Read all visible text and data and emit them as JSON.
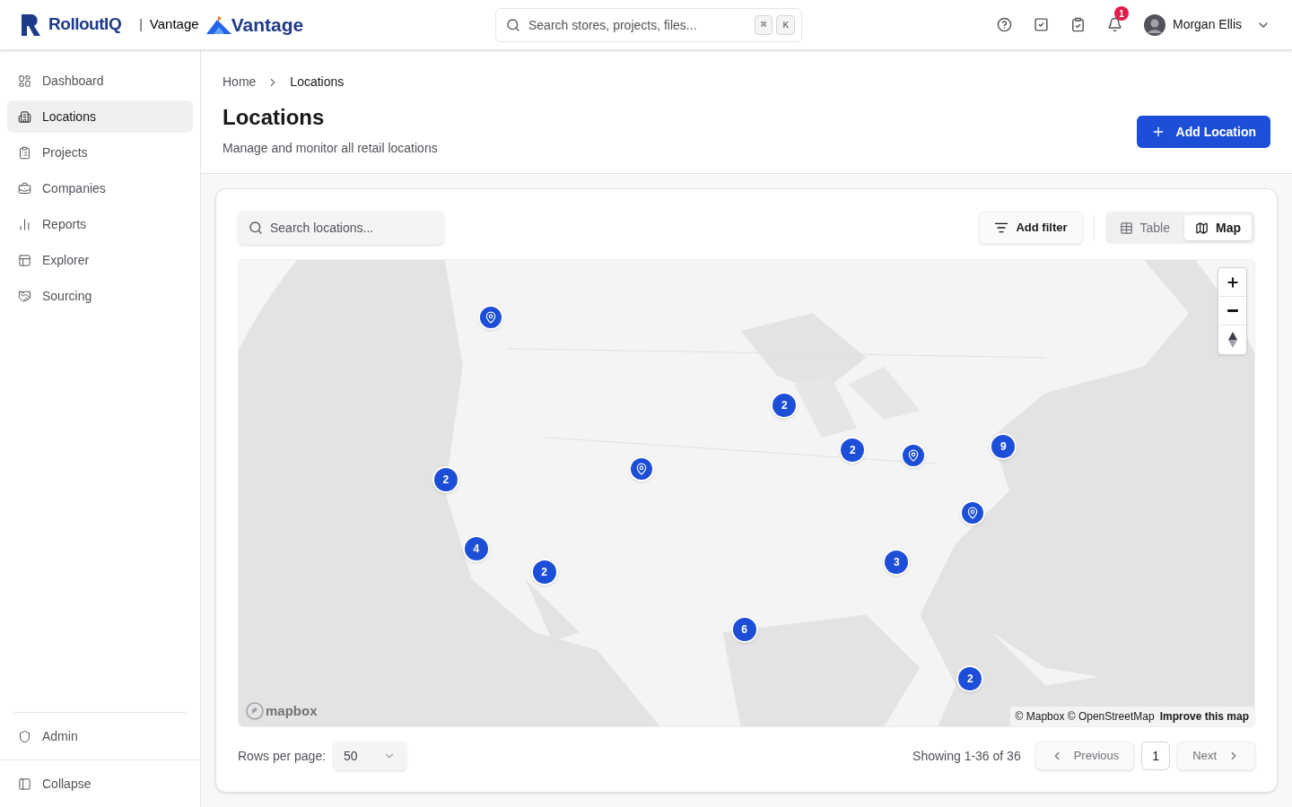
{
  "header": {
    "brand": "RolloutIQ",
    "separator": "|",
    "product_label": "Vantage",
    "product_logo": "Vantage",
    "search": {
      "placeholder": "Search stores, projects, files..."
    },
    "shortcut_keys": [
      "⌘",
      "K"
    ],
    "notification_count": "1",
    "user_name": "Morgan Ellis"
  },
  "sidebar": {
    "items": [
      {
        "label": "Dashboard",
        "selected": false
      },
      {
        "label": "Locations",
        "selected": true
      },
      {
        "label": "Projects",
        "selected": false
      },
      {
        "label": "Companies",
        "selected": false
      },
      {
        "label": "Reports",
        "selected": false
      },
      {
        "label": "Explorer",
        "selected": false
      },
      {
        "label": "Sourcing",
        "selected": false
      }
    ],
    "admin": "Admin",
    "collapse": "Collapse"
  },
  "breadcrumb": [
    "Home",
    "Locations"
  ],
  "page": {
    "title": "Locations",
    "subtitle": "Manage and monitor all retail locations",
    "add_button": "Add Location"
  },
  "toolbar": {
    "search": {
      "placeholder": "Search locations..."
    },
    "filter_button": "Add filter",
    "views": [
      {
        "label": "Table",
        "selected": false
      },
      {
        "label": "Map",
        "selected": true
      }
    ]
  },
  "map": {
    "markers": [
      {
        "kind": "pin"
      },
      {
        "kind": "cluster",
        "count": "2"
      },
      {
        "kind": "cluster",
        "count": "2"
      },
      {
        "kind": "pin"
      },
      {
        "kind": "cluster",
        "count": "9"
      },
      {
        "kind": "pin"
      },
      {
        "kind": "cluster",
        "count": "2"
      },
      {
        "kind": "pin"
      },
      {
        "kind": "cluster",
        "count": "4"
      },
      {
        "kind": "cluster",
        "count": "2"
      },
      {
        "kind": "cluster",
        "count": "3"
      },
      {
        "kind": "cluster",
        "count": "6"
      },
      {
        "kind": "cluster",
        "count": "2"
      }
    ],
    "logo": "mapbox",
    "attribution": "© Mapbox © OpenStreetMap",
    "improve_link": "Improve this map"
  },
  "footer": {
    "rows_label": "Rows per page:",
    "rows_value": "50",
    "showing": "Showing 1-36 of 36",
    "previous": "Previous",
    "pages": [
      {
        "label": "1",
        "selected": true
      }
    ],
    "next": "Next"
  }
}
